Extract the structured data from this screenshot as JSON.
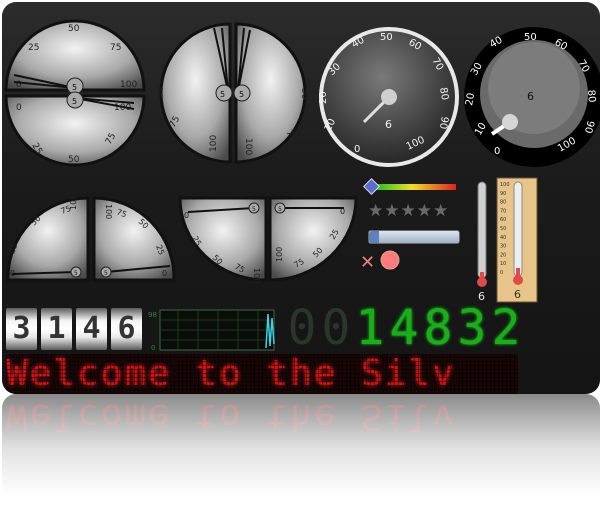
{
  "gauges": {
    "quarter_top_left": {
      "ticks": [
        "0",
        "25",
        "50",
        "75",
        "100"
      ],
      "value": "5"
    },
    "quarter_bottom_left": {
      "ticks": [
        "0",
        "25",
        "50",
        "75",
        "100"
      ],
      "value": "5"
    },
    "quarter_left_pair": {
      "ticks": [
        "50",
        "75",
        "100"
      ],
      "value": "5"
    },
    "quarter_right_pair": {
      "ticks": [
        "50",
        "75",
        "100"
      ],
      "value": "5"
    },
    "dial_dark": {
      "ticks": [
        "0",
        "10",
        "20",
        "30",
        "40",
        "50",
        "60",
        "70",
        "80",
        "90",
        "100"
      ],
      "value": "6"
    },
    "dial_black": {
      "ticks": [
        "0",
        "10",
        "20",
        "30",
        "40",
        "50",
        "60",
        "70",
        "80",
        "90",
        "100"
      ],
      "value": "6"
    },
    "small_left": {
      "ticks": [
        "0",
        "25",
        "50",
        "75",
        "100"
      ],
      "value": "5"
    },
    "small_right": {
      "ticks": [
        "0",
        "25",
        "50",
        "75",
        "100"
      ],
      "value": "5"
    },
    "wide_left": {
      "ticks": [
        "0",
        "25",
        "50",
        "75",
        "100"
      ],
      "value": "5"
    },
    "wide_right": {
      "ticks": [
        "0",
        "25",
        "50",
        "75",
        "100"
      ],
      "value": "5"
    }
  },
  "thermometer": {
    "value": "6"
  },
  "thermometer_framed": {
    "value": "6",
    "scale": [
      "100",
      "90",
      "80",
      "70",
      "60",
      "50",
      "40",
      "30",
      "20",
      "10",
      "0"
    ]
  },
  "odometer": {
    "digits": [
      "3",
      "1",
      "4",
      "6"
    ]
  },
  "chart": {
    "y_max": "98",
    "y_min": "0"
  },
  "segment_display": {
    "digits": [
      "0",
      "0",
      "1",
      "4",
      "8",
      "3",
      "2"
    ],
    "lit": [
      false,
      false,
      true,
      true,
      true,
      true,
      true
    ]
  },
  "led_marquee": {
    "text": "Welcome to the Silv"
  },
  "rating": {
    "stars": 5,
    "filled": 0
  },
  "colors": {
    "led": "#e01010",
    "segment": "#18b018",
    "accent_gold": "#e0c080"
  }
}
